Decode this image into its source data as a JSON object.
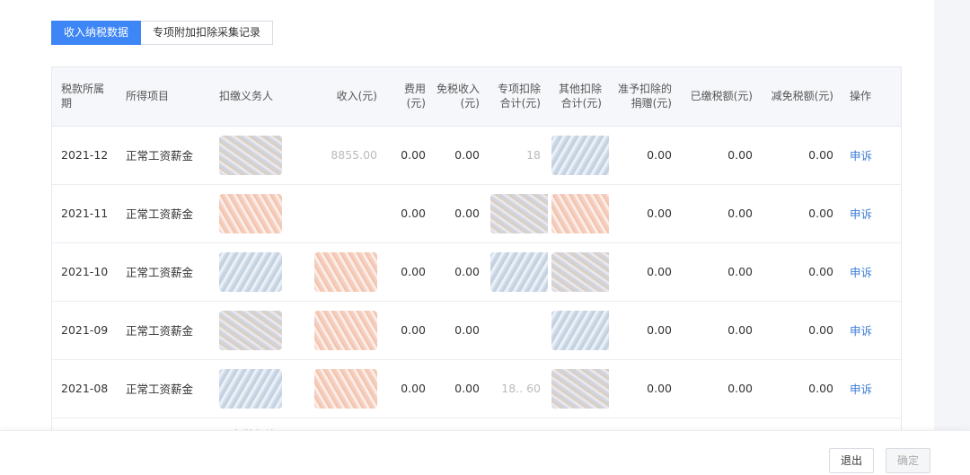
{
  "tabs": [
    {
      "label": "收入纳税数据",
      "active": true
    },
    {
      "label": "专项附加扣除采集记录",
      "active": false
    }
  ],
  "table": {
    "headers": {
      "period": "税款所属期",
      "item": "所得项目",
      "withholder": "扣缴义务人",
      "income": "收入(元)",
      "cost": "费用(元)",
      "taxfree": "免税收入(元)",
      "special": "专项扣除合计(元)",
      "other": "其他扣除合计(元)",
      "donation": "准予扣除的捐赠(元)",
      "paid": "已缴税额(元)",
      "reduced": "减免税额(元)",
      "action": "操作"
    },
    "rows": [
      {
        "period": "2021-12",
        "item": "正常工资薪金",
        "income": "8855.00",
        "special": "18",
        "cost": "0.00",
        "taxfree": "0.00",
        "donation": "0.00",
        "paid": "0.00",
        "reduced": "0.00",
        "action": "申诉"
      },
      {
        "period": "2021-11",
        "item": "正常工资薪金",
        "income": "",
        "special": "",
        "cost": "0.00",
        "taxfree": "0.00",
        "donation": "0.00",
        "paid": "0.00",
        "reduced": "0.00",
        "action": "申诉"
      },
      {
        "period": "2021-10",
        "item": "正常工资薪金",
        "income": "",
        "special": "",
        "cost": "0.00",
        "taxfree": "0.00",
        "donation": "0.00",
        "paid": "0.00",
        "reduced": "0.00",
        "action": "申诉"
      },
      {
        "period": "2021-09",
        "item": "正常工资薪金",
        "income": "",
        "special": "",
        "cost": "0.00",
        "taxfree": "0.00",
        "donation": "0.00",
        "paid": "0.00",
        "reduced": "0.00",
        "action": "申诉"
      },
      {
        "period": "2021-08",
        "item": "正常工资薪金",
        "income": "",
        "special": "18.. 60",
        "cost": "0.00",
        "taxfree": "0.00",
        "donation": "0.00",
        "paid": "0.00",
        "reduced": "0.00",
        "action": "申诉"
      }
    ],
    "partial_row_text": "国家税务总局"
  },
  "footer": {
    "exit_label": "退出",
    "confirm_label": "确定"
  },
  "colors": {
    "accent": "#3e86f5",
    "link": "#3e7fd8"
  }
}
